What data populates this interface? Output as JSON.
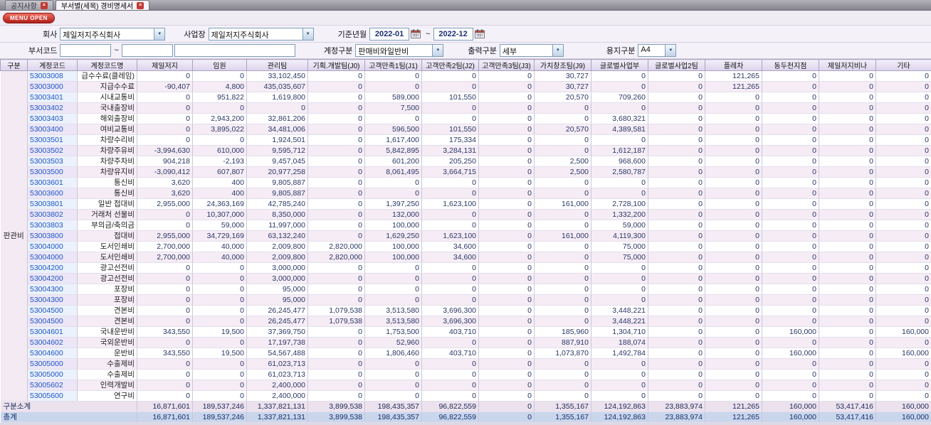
{
  "tabs": [
    {
      "label": "공지사항",
      "active": false
    },
    {
      "label": "부서별(세목) 경비명세서",
      "active": true
    }
  ],
  "menu_button": "MENU OPEN",
  "filters": {
    "company_label": "회사",
    "company_value": "제일저지주식회사",
    "workplace_label": "사업장",
    "workplace_value": "제일저지주식회사",
    "period_label": "기준년월",
    "period_from": "2022-01",
    "period_to": "2022-12",
    "tilde": "~",
    "dept_code_label": "부서코드",
    "dept_code_from": "",
    "dept_code_to": "",
    "dept_name": "",
    "account_type_label": "계정구분",
    "account_type_value": "판매비와일반비",
    "output_label": "출력구분",
    "output_value": "세부",
    "paper_label": "용지구분",
    "paper_value": "A4"
  },
  "table": {
    "headers": [
      "구분",
      "계정코드",
      "계정코드명",
      "제일저지",
      "임원",
      "관리팀",
      "기획.개발팀(J0)",
      "고객만족1팀(J1)",
      "고객만족2팀(J2)",
      "고객만족3팀(J3)",
      "가치창조팀(J9)",
      "글로벌사업부",
      "글로벌사업2팀",
      "플레차",
      "동두천지점",
      "제일저지비나",
      "기타"
    ],
    "group_label": "판관비",
    "rows": [
      {
        "code": "53003008",
        "name": "급수수료(클레임)",
        "values": [
          "0",
          "0",
          "33,102,450",
          "0",
          "0",
          "0",
          "0",
          "30,727",
          "0",
          "0",
          "121,265",
          "0",
          "0",
          "0"
        ]
      },
      {
        "code": "53003000",
        "name": "지급수수료",
        "values": [
          "-90,407",
          "4,800",
          "435,035,607",
          "0",
          "0",
          "0",
          "0",
          "30,727",
          "0",
          "0",
          "121,265",
          "0",
          "0",
          "0"
        ]
      },
      {
        "code": "53003401",
        "name": "시내교통비",
        "values": [
          "0",
          "951,822",
          "1,619,800",
          "0",
          "589,000",
          "101,550",
          "0",
          "20,570",
          "709,260",
          "0",
          "0",
          "0",
          "0",
          "0"
        ]
      },
      {
        "code": "53003402",
        "name": "국내출장비",
        "values": [
          "0",
          "0",
          "0",
          "0",
          "7,500",
          "0",
          "0",
          "0",
          "0",
          "0",
          "0",
          "0",
          "0",
          "0"
        ]
      },
      {
        "code": "53003403",
        "name": "해외출장비",
        "values": [
          "0",
          "2,943,200",
          "32,861,206",
          "0",
          "0",
          "0",
          "0",
          "0",
          "3,680,321",
          "0",
          "0",
          "0",
          "0",
          "0"
        ]
      },
      {
        "code": "53003400",
        "name": "여비교통비",
        "values": [
          "0",
          "3,895,022",
          "34,481,006",
          "0",
          "596,500",
          "101,550",
          "0",
          "20,570",
          "4,389,581",
          "0",
          "0",
          "0",
          "0",
          "0"
        ]
      },
      {
        "code": "53003501",
        "name": "차량수리비",
        "values": [
          "0",
          "0",
          "1,924,501",
          "0",
          "1,617,400",
          "175,334",
          "0",
          "0",
          "0",
          "0",
          "0",
          "0",
          "0",
          "0"
        ]
      },
      {
        "code": "53003502",
        "name": "차량주유비",
        "values": [
          "-3,994,630",
          "610,000",
          "9,595,712",
          "0",
          "5,842,895",
          "3,284,131",
          "0",
          "0",
          "1,612,187",
          "0",
          "0",
          "0",
          "0",
          "0"
        ]
      },
      {
        "code": "53003503",
        "name": "차량주차비",
        "values": [
          "904,218",
          "-2,193",
          "9,457,045",
          "0",
          "601,200",
          "205,250",
          "0",
          "2,500",
          "968,600",
          "0",
          "0",
          "0",
          "0",
          "0"
        ]
      },
      {
        "code": "53003500",
        "name": "차량유지비",
        "values": [
          "-3,090,412",
          "607,807",
          "20,977,258",
          "0",
          "8,061,495",
          "3,664,715",
          "0",
          "2,500",
          "2,580,787",
          "0",
          "0",
          "0",
          "0",
          "0"
        ]
      },
      {
        "code": "53003601",
        "name": "통신비",
        "values": [
          "3,620",
          "400",
          "9,805,887",
          "0",
          "0",
          "0",
          "0",
          "0",
          "0",
          "0",
          "0",
          "0",
          "0",
          "0"
        ]
      },
      {
        "code": "53003600",
        "name": "통신비",
        "values": [
          "3,620",
          "400",
          "9,805,887",
          "0",
          "0",
          "0",
          "0",
          "0",
          "0",
          "0",
          "0",
          "0",
          "0",
          "0"
        ]
      },
      {
        "code": "53003801",
        "name": "일반 접대비",
        "values": [
          "2,955,000",
          "24,363,169",
          "42,785,240",
          "0",
          "1,397,250",
          "1,623,100",
          "0",
          "161,000",
          "2,728,100",
          "0",
          "0",
          "0",
          "0",
          "0"
        ]
      },
      {
        "code": "53003802",
        "name": "거래처 선물비",
        "values": [
          "0",
          "10,307,000",
          "8,350,000",
          "0",
          "132,000",
          "0",
          "0",
          "0",
          "1,332,200",
          "0",
          "0",
          "0",
          "0",
          "0"
        ]
      },
      {
        "code": "53003803",
        "name": "부의금/축의금",
        "values": [
          "0",
          "59,000",
          "11,997,000",
          "0",
          "100,000",
          "0",
          "0",
          "0",
          "59,000",
          "0",
          "0",
          "0",
          "0",
          "0"
        ]
      },
      {
        "code": "53003800",
        "name": "접대비",
        "values": [
          "2,955,000",
          "34,729,169",
          "63,132,240",
          "0",
          "1,629,250",
          "1,623,100",
          "0",
          "161,000",
          "4,119,300",
          "0",
          "0",
          "0",
          "0",
          "0"
        ]
      },
      {
        "code": "53004000",
        "name": "도서인쇄비",
        "values": [
          "2,700,000",
          "40,000",
          "2,009,800",
          "2,820,000",
          "100,000",
          "34,600",
          "0",
          "0",
          "75,000",
          "0",
          "0",
          "0",
          "0",
          "0"
        ]
      },
      {
        "code": "53004000",
        "name": "도서인쇄비",
        "values": [
          "2,700,000",
          "40,000",
          "2,009,800",
          "2,820,000",
          "100,000",
          "34,600",
          "0",
          "0",
          "75,000",
          "0",
          "0",
          "0",
          "0",
          "0"
        ]
      },
      {
        "code": "53004200",
        "name": "광고선전비",
        "values": [
          "0",
          "0",
          "3,000,000",
          "0",
          "0",
          "0",
          "0",
          "0",
          "0",
          "0",
          "0",
          "0",
          "0",
          "0"
        ]
      },
      {
        "code": "53004200",
        "name": "광고선전비",
        "values": [
          "0",
          "0",
          "3,000,000",
          "0",
          "0",
          "0",
          "0",
          "0",
          "0",
          "0",
          "0",
          "0",
          "0",
          "0"
        ]
      },
      {
        "code": "53004300",
        "name": "포장비",
        "values": [
          "0",
          "0",
          "95,000",
          "0",
          "0",
          "0",
          "0",
          "0",
          "0",
          "0",
          "0",
          "0",
          "0",
          "0"
        ]
      },
      {
        "code": "53004300",
        "name": "포장비",
        "values": [
          "0",
          "0",
          "95,000",
          "0",
          "0",
          "0",
          "0",
          "0",
          "0",
          "0",
          "0",
          "0",
          "0",
          "0"
        ]
      },
      {
        "code": "53004500",
        "name": "견본비",
        "values": [
          "0",
          "0",
          "26,245,477",
          "1,079,538",
          "3,513,580",
          "3,696,300",
          "0",
          "0",
          "3,448,221",
          "0",
          "0",
          "0",
          "0",
          "0"
        ]
      },
      {
        "code": "53004500",
        "name": "견본비",
        "values": [
          "0",
          "0",
          "26,245,477",
          "1,079,538",
          "3,513,580",
          "3,696,300",
          "0",
          "0",
          "3,448,221",
          "0",
          "0",
          "0",
          "0",
          "0"
        ]
      },
      {
        "code": "53004601",
        "name": "국내운반비",
        "values": [
          "343,550",
          "19,500",
          "37,369,750",
          "0",
          "1,753,500",
          "403,710",
          "0",
          "185,960",
          "1,304,710",
          "0",
          "0",
          "160,000",
          "0",
          "160,000"
        ]
      },
      {
        "code": "53004602",
        "name": "국외운반비",
        "values": [
          "0",
          "0",
          "17,197,738",
          "0",
          "52,960",
          "0",
          "0",
          "887,910",
          "188,074",
          "0",
          "0",
          "0",
          "0",
          "0"
        ]
      },
      {
        "code": "53004600",
        "name": "운반비",
        "values": [
          "343,550",
          "19,500",
          "54,567,488",
          "0",
          "1,806,460",
          "403,710",
          "0",
          "1,073,870",
          "1,492,784",
          "0",
          "0",
          "160,000",
          "0",
          "160,000"
        ]
      },
      {
        "code": "53005000",
        "name": "수출제비",
        "values": [
          "0",
          "0",
          "61,023,713",
          "0",
          "0",
          "0",
          "0",
          "0",
          "0",
          "0",
          "0",
          "0",
          "0",
          "0"
        ]
      },
      {
        "code": "53005000",
        "name": "수출제비",
        "values": [
          "0",
          "0",
          "61,023,713",
          "0",
          "0",
          "0",
          "0",
          "0",
          "0",
          "0",
          "0",
          "0",
          "0",
          "0"
        ]
      },
      {
        "code": "53005602",
        "name": "인력개발비",
        "values": [
          "0",
          "0",
          "2,400,000",
          "0",
          "0",
          "0",
          "0",
          "0",
          "0",
          "0",
          "0",
          "0",
          "0",
          "0"
        ]
      },
      {
        "code": "53005600",
        "name": "연구비",
        "values": [
          "0",
          "0",
          "2,400,000",
          "0",
          "0",
          "0",
          "0",
          "0",
          "0",
          "0",
          "0",
          "0",
          "0",
          "0"
        ]
      }
    ],
    "subtotal_label": "구분소계",
    "subtotal_values": [
      "16,871,601",
      "189,537,246",
      "1,337,821,131",
      "3,899,538",
      "198,435,357",
      "96,822,559",
      "0",
      "1,355,167",
      "124,192,863",
      "23,883,974",
      "121,265",
      "160,000",
      "53,417,416",
      "160,000"
    ],
    "total_label": "총계",
    "total_values": [
      "16,871,601",
      "189,537,246",
      "1,337,821,131",
      "3,899,538",
      "198,435,357",
      "96,822,559",
      "0",
      "1,355,167",
      "124,192,863",
      "23,883,974",
      "121,265",
      "160,000",
      "53,417,416",
      "160,000"
    ]
  }
}
